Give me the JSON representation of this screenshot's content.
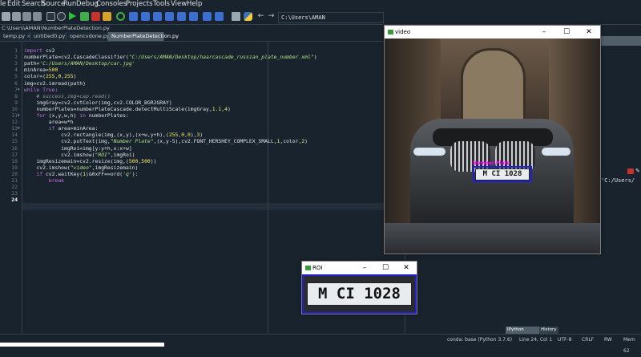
{
  "window": {
    "title_prefix": "le"
  },
  "menu": [
    "Edit",
    "Search",
    "Source",
    "Run",
    "Debug",
    "Consoles",
    "Projects",
    "Tools",
    "View",
    "Help"
  ],
  "toolbar": {
    "path_value": "C:\\Users\\AMAN"
  },
  "file_path": "C:\\Users\\AMAN\\NumberPlateDetection.py",
  "tabs": [
    {
      "label": "temp.py",
      "active": false
    },
    {
      "label": "untitled0.py",
      "active": false
    },
    {
      "label": "opencvdone.py",
      "active": false
    },
    {
      "label": "NumberPlateDetection.py",
      "active": true
    }
  ],
  "editor": {
    "line_numbers": [
      "1",
      "2",
      "3",
      "4",
      "5",
      "6",
      "7",
      "8",
      "9",
      "10",
      "11",
      "12",
      "13",
      "14",
      "15",
      "16",
      "17",
      "18",
      "19",
      "20",
      "21",
      "22",
      "23",
      "24"
    ],
    "current_line": "24",
    "lines": [
      "import cv2",
      "numberPlate=cv2.CascadeClassifier(\"C:/Users/AMAN/Desktop/haarcascade_russian_plate_number.xml\")",
      "path='C:/Users/AMAN/Desktop/car.jpg'",
      "minArea=500",
      "color=(255,0,255)",
      "img=cv2.imread(path)",
      "while True:",
      "    # success,img=cap.read()",
      "    imgGray=cv2.cvtColor(img,cv2.COLOR_BGR2GRAY)",
      "    numberPlates=numberPlateCascade.detectMultiScale(imgGray,1.1,4)",
      "    for (x,y,w,h) in numberPlates:",
      "        area=w*h",
      "        if area>minArea:",
      "            cv2.rectangle(img,(x,y),(x+w,y+h),(255,0,0),3)",
      "            cv2.putText(img,\"Number Plate\",(x,y-5),cv2.FONT_HERSHEY_COMPLEX_SMALL,1,color,2)",
      "            imgRoi=img[y:y+h,x:x+w]",
      "            cv2.imshow(\"ROI\",imgRoi)",
      "    imgResizemain=cv2.resize(img,(500,500))",
      "    cv2.imshow(\"video\",imgResizemain)",
      "    if cv2.waitKey(1)&0xFF==ord('q'):",
      "        break",
      "",
      "",
      ""
    ]
  },
  "right_pane": {
    "console_text": "'C:/Users/",
    "tab_console": "IPython console",
    "tab_history": "History"
  },
  "statusbar": {
    "conda": "conda: base (Python 3.7.6)",
    "position": "Line 24, Col 1",
    "encoding": "UTF-8",
    "eol": "CRLF",
    "rw": "RW",
    "mem": "Mem 62"
  },
  "video_window": {
    "title": "video",
    "plate_text": "M CI 1028",
    "label_text": "Number Plate"
  },
  "roi_window": {
    "title": "ROI",
    "plate_text": "M CI 1028"
  },
  "colors": {
    "bg": "#19232d",
    "accent": "#505f69",
    "keyword": "#c670e0",
    "string": "#b0e686",
    "number": "#faed5c",
    "comment": "#999999",
    "rect_blue": "#1f1fd0",
    "magenta": "#ff00ff"
  }
}
